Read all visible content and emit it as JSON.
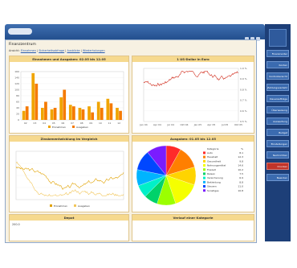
{
  "window": {
    "title": "Finanzzentrum",
    "links": [
      {
        "label": "Ansicht:"
      },
      {
        "label": "Einnahmen"
      },
      {
        "label": "Sicherheitsabfrage"
      },
      {
        "label": "Ausblicke"
      },
      {
        "label": "Wiederholungen"
      }
    ]
  },
  "panels": {
    "income": {
      "title": "Einnahmen und Ausgaben: 02.05 bis 12.05",
      "legend": [
        "Einnahmen",
        "Ausgaben"
      ],
      "yticks": [
        "160",
        "140",
        "120",
        "100",
        "80",
        "60",
        "40",
        "20",
        "0"
      ]
    },
    "fx": {
      "title": "1 US-Dollar in Euro",
      "xticks": [
        "Jan 04",
        "Apr 04",
        "Jul 04",
        "Okt 04",
        "Jan 05",
        "Apr 05",
        "Jul 05",
        "Okt 05"
      ],
      "yticks": [
        "1.0 %",
        "0.9 %",
        "0.8 %",
        "0.7 %",
        "0.6 %",
        "0.5 %"
      ]
    },
    "interest": {
      "title": "Zinsbenentwicklung im Vergleich",
      "legend": [
        "Einnahmen",
        "Ausgaben"
      ]
    },
    "pie": {
      "title": "Ausgaben: 01.05 bis 12.05",
      "legend_header": [
        "Kategorie",
        "%"
      ],
      "legend": [
        {
          "label": "Auto",
          "pct": "8.1",
          "color": "#ff2a2a"
        },
        {
          "label": "Haushalt",
          "pct": "12.3",
          "color": "#ff7f00"
        },
        {
          "label": "Gesundheit",
          "pct": "9.8",
          "color": "#ffd400"
        },
        {
          "label": "Nahrungsmittel",
          "pct": "14.6",
          "color": "#f5ff00"
        },
        {
          "label": "Freizeit",
          "pct": "10.2",
          "color": "#9bff00"
        },
        {
          "label": "Reisen",
          "pct": "7.5",
          "color": "#00d26a"
        },
        {
          "label": "Versicherung",
          "pct": "6.9",
          "color": "#00f0c8"
        },
        {
          "label": "Bekleidung",
          "pct": "8.8",
          "color": "#00b4ff"
        },
        {
          "label": "Steuern",
          "pct": "11.0",
          "color": "#0047ff"
        },
        {
          "label": "Sonstiges",
          "pct": "10.8",
          "color": "#7a1cff"
        }
      ]
    },
    "depot": {
      "title": "Depot",
      "value": "200.0"
    },
    "history": {
      "title": "Verlauf einer Kategorie"
    }
  },
  "sidebar": {
    "items": [
      {
        "label": "Finanzcenter",
        "color": "#3b6bb0"
      },
      {
        "label": "Konten",
        "color": "#3b6bb0"
      },
      {
        "label": "Kontoübersicht",
        "color": "#3b6bb0"
      },
      {
        "label": "Zahlungsverkehr",
        "color": "#3b6bb0"
      },
      {
        "label": "Daueraufträge",
        "color": "#3b6bb0"
      },
      {
        "label": "Überweisung",
        "color": "#3b6bb0"
      },
      {
        "label": "Auswertung",
        "color": "#3b6bb0"
      },
      {
        "label": "Budget",
        "color": "#3b6bb0"
      },
      {
        "label": "Einstellungen",
        "color": "#3b6bb0"
      },
      {
        "label": "Nachrichten",
        "color": "#3b6bb0"
      },
      {
        "label": "Drucken",
        "color": "#c0342a"
      },
      {
        "label": "Beenden",
        "color": "#3b6bb0"
      }
    ]
  },
  "chart_data": [
    {
      "type": "bar",
      "title": "Einnahmen und Ausgaben: 02.05 bis 12.05",
      "categories": [
        "02",
        "03",
        "04",
        "05",
        "06",
        "07",
        "08",
        "09",
        "10",
        "11",
        "12"
      ],
      "series": [
        {
          "name": "Einnahmen",
          "values": [
            30,
            155,
            40,
            35,
            75,
            50,
            40,
            45,
            60,
            70,
            40
          ]
        },
        {
          "name": "Ausgaben",
          "values": [
            45,
            120,
            60,
            40,
            100,
            45,
            35,
            25,
            40,
            55,
            30
          ]
        }
      ],
      "ylim": [
        0,
        160
      ]
    },
    {
      "type": "line",
      "title": "1 US-Dollar in Euro",
      "ylim": [
        0.5,
        1.0
      ]
    },
    {
      "type": "line",
      "title": "Zinsbenentwicklung im Vergleich"
    },
    {
      "type": "pie",
      "title": "Ausgaben: 01.05 bis 12.05"
    }
  ]
}
